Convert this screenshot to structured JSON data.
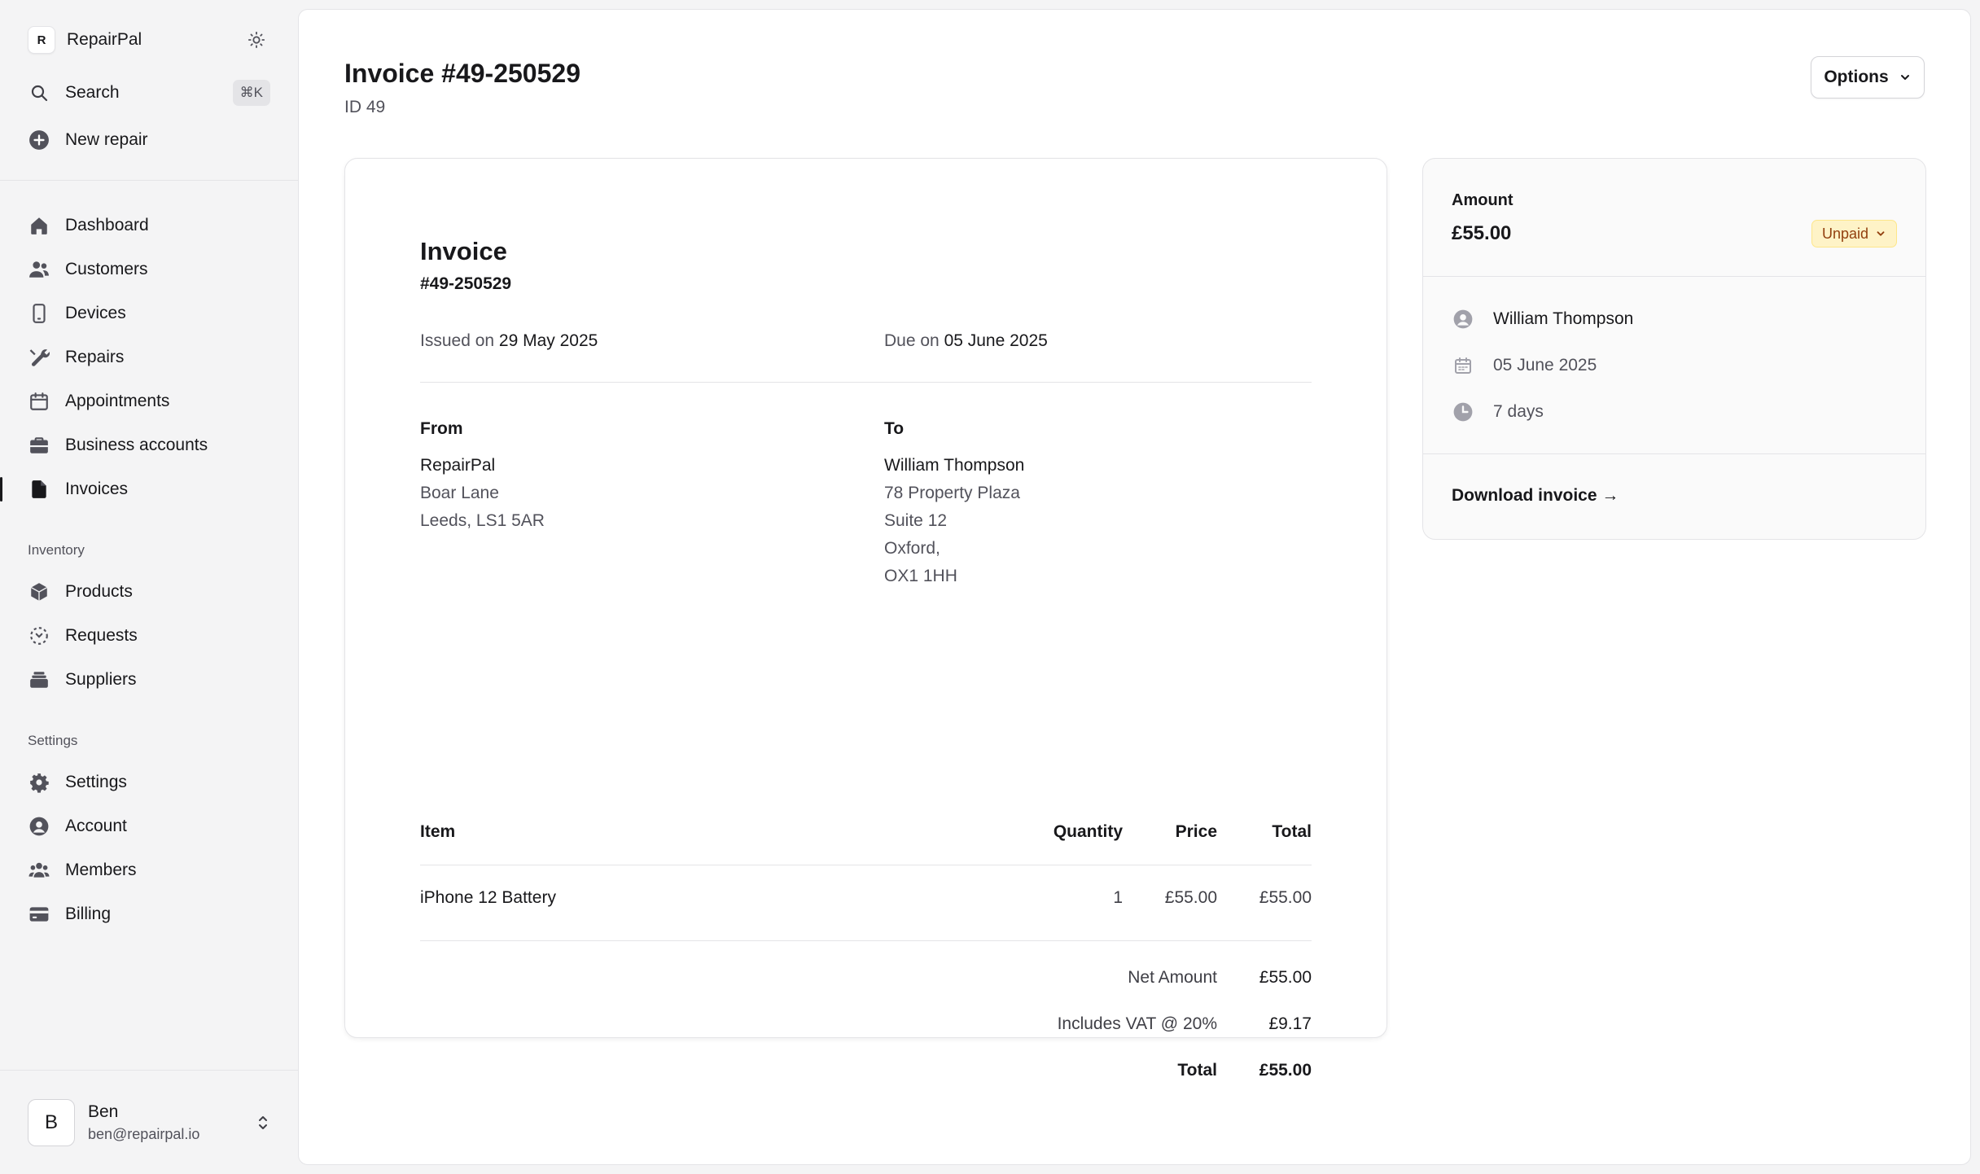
{
  "app": {
    "name": "RepairPal",
    "logo_letter": "R"
  },
  "search": {
    "label": "Search",
    "shortcut": "⌘K"
  },
  "new_repair": {
    "label": "New repair"
  },
  "nav": {
    "main": [
      {
        "label": "Dashboard",
        "icon": "home-icon"
      },
      {
        "label": "Customers",
        "icon": "users-icon"
      },
      {
        "label": "Devices",
        "icon": "phone-icon"
      },
      {
        "label": "Repairs",
        "icon": "wrench-icon"
      },
      {
        "label": "Appointments",
        "icon": "calendar-icon"
      },
      {
        "label": "Business accounts",
        "icon": "briefcase-icon"
      },
      {
        "label": "Invoices",
        "icon": "document-icon",
        "active": true
      }
    ],
    "inventory_title": "Inventory",
    "inventory": [
      {
        "label": "Products",
        "icon": "cube-icon"
      },
      {
        "label": "Requests",
        "icon": "request-icon"
      },
      {
        "label": "Suppliers",
        "icon": "stack-icon"
      }
    ],
    "settings_title": "Settings",
    "settings": [
      {
        "label": "Settings",
        "icon": "gear-icon"
      },
      {
        "label": "Account",
        "icon": "user-circle-icon"
      },
      {
        "label": "Members",
        "icon": "group-icon"
      },
      {
        "label": "Billing",
        "icon": "credit-card-icon"
      }
    ]
  },
  "user": {
    "initial": "B",
    "name": "Ben",
    "email": "ben@repairpal.io"
  },
  "page": {
    "title": "Invoice #49-250529",
    "subtitle": "ID 49",
    "options_label": "Options"
  },
  "invoice": {
    "heading": "Invoice",
    "number": "#49-250529",
    "issued_prefix": "Issued on",
    "issued_date": "29 May 2025",
    "due_prefix": "Due on",
    "due_date": "05 June 2025",
    "from": {
      "heading": "From",
      "name": "RepairPal",
      "line1": "Boar Lane",
      "line2": "Leeds, LS1 5AR"
    },
    "to": {
      "heading": "To",
      "name": "William Thompson",
      "line1": "78 Property Plaza",
      "line2": "Suite 12",
      "line3": "Oxford,",
      "line4": "OX1 1HH"
    },
    "columns": {
      "item": "Item",
      "quantity": "Quantity",
      "price": "Price",
      "total": "Total"
    },
    "items": [
      {
        "item": "iPhone 12 Battery",
        "quantity": "1",
        "price": "£55.00",
        "total": "£55.00"
      }
    ],
    "net_label": "Net Amount",
    "net_value": "£55.00",
    "vat_label": "Includes VAT @ 20%",
    "vat_value": "£9.17",
    "total_label": "Total",
    "total_value": "£55.00"
  },
  "summary": {
    "amount_label": "Amount",
    "amount": "£55.00",
    "status": "Unpaid",
    "customer": "William Thompson",
    "due_date": "05 June 2025",
    "terms": "7 days",
    "download_label": "Download invoice →"
  },
  "colors": {
    "sidebar_bg": "#f4f4f5",
    "text": "#18181b",
    "muted": "#52525b",
    "badge_bg": "#fef3c7",
    "badge_text": "#92400e"
  }
}
